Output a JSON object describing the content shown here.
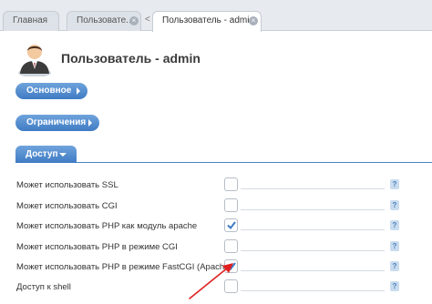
{
  "tabs": [
    {
      "label": "Главная"
    },
    {
      "label": "Пользовате..."
    },
    {
      "label": "Пользователь - admin"
    }
  ],
  "tab_separator": "<",
  "page": {
    "title": "Пользователь - admin"
  },
  "sections": {
    "basic": "Основное",
    "limits": "Ограничения",
    "access": "Доступ"
  },
  "access_rows": [
    {
      "label": "Может использовать SSL",
      "checked": false
    },
    {
      "label": "Может использовать CGI",
      "checked": false
    },
    {
      "label": "Может использовать PHP как модуль apache",
      "checked": true
    },
    {
      "label": "Может использовать PHP в режиме CGI",
      "checked": false
    },
    {
      "label": "Может использовать PHP в режиме FastCGI (Apache)",
      "checked": true
    },
    {
      "label": "Доступ к shell",
      "checked": false
    }
  ],
  "help_glyph": "?",
  "close_glyph": "×",
  "colors": {
    "accent": "#4a83c8",
    "annotation": "#e02020",
    "check": "#3f7bc4"
  }
}
